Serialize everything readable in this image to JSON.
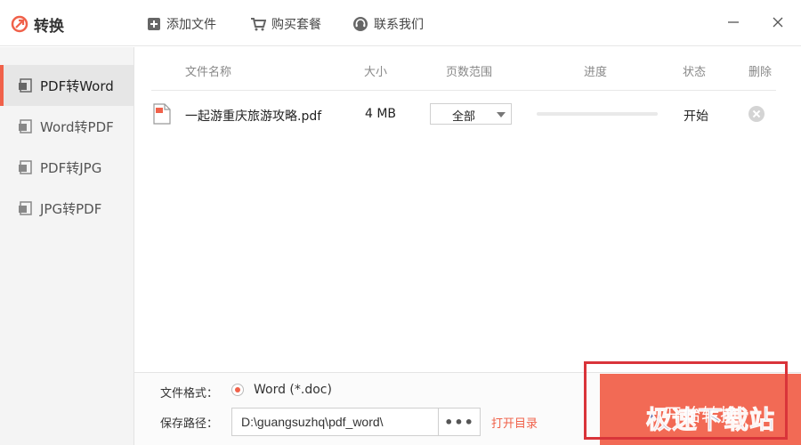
{
  "app": {
    "title": "转换",
    "accent": "#f0614a"
  },
  "toolbar": {
    "add_file": "添加文件",
    "buy_package": "购买套餐",
    "contact_us": "联系我们"
  },
  "sidebar": {
    "items": [
      {
        "label": "PDF转Word",
        "icon": "document-icon",
        "active": true
      },
      {
        "label": "Word转PDF",
        "icon": "document-icon",
        "active": false
      },
      {
        "label": "PDF转JPG",
        "icon": "image-icon",
        "active": false
      },
      {
        "label": "JPG转PDF",
        "icon": "image-icon",
        "active": false
      }
    ]
  },
  "table": {
    "headers": {
      "name": "文件名称",
      "size": "大小",
      "pages": "页数范围",
      "progress": "进度",
      "status": "状态",
      "delete": "删除"
    },
    "rows": [
      {
        "name": "一起游重庆旅游攻略.pdf",
        "size": "4 MB",
        "pages": "全部",
        "progress": 0,
        "status": "开始"
      }
    ]
  },
  "bottom": {
    "format_label": "文件格式：",
    "format_option": "Word (*.doc)",
    "save_label": "保存路径：",
    "save_path": "D:\\guangsuzhq\\pdf_word\\",
    "browse": "•••",
    "open_dir": "打开目录",
    "start": "开始转换"
  },
  "watermark": "极速下载站"
}
